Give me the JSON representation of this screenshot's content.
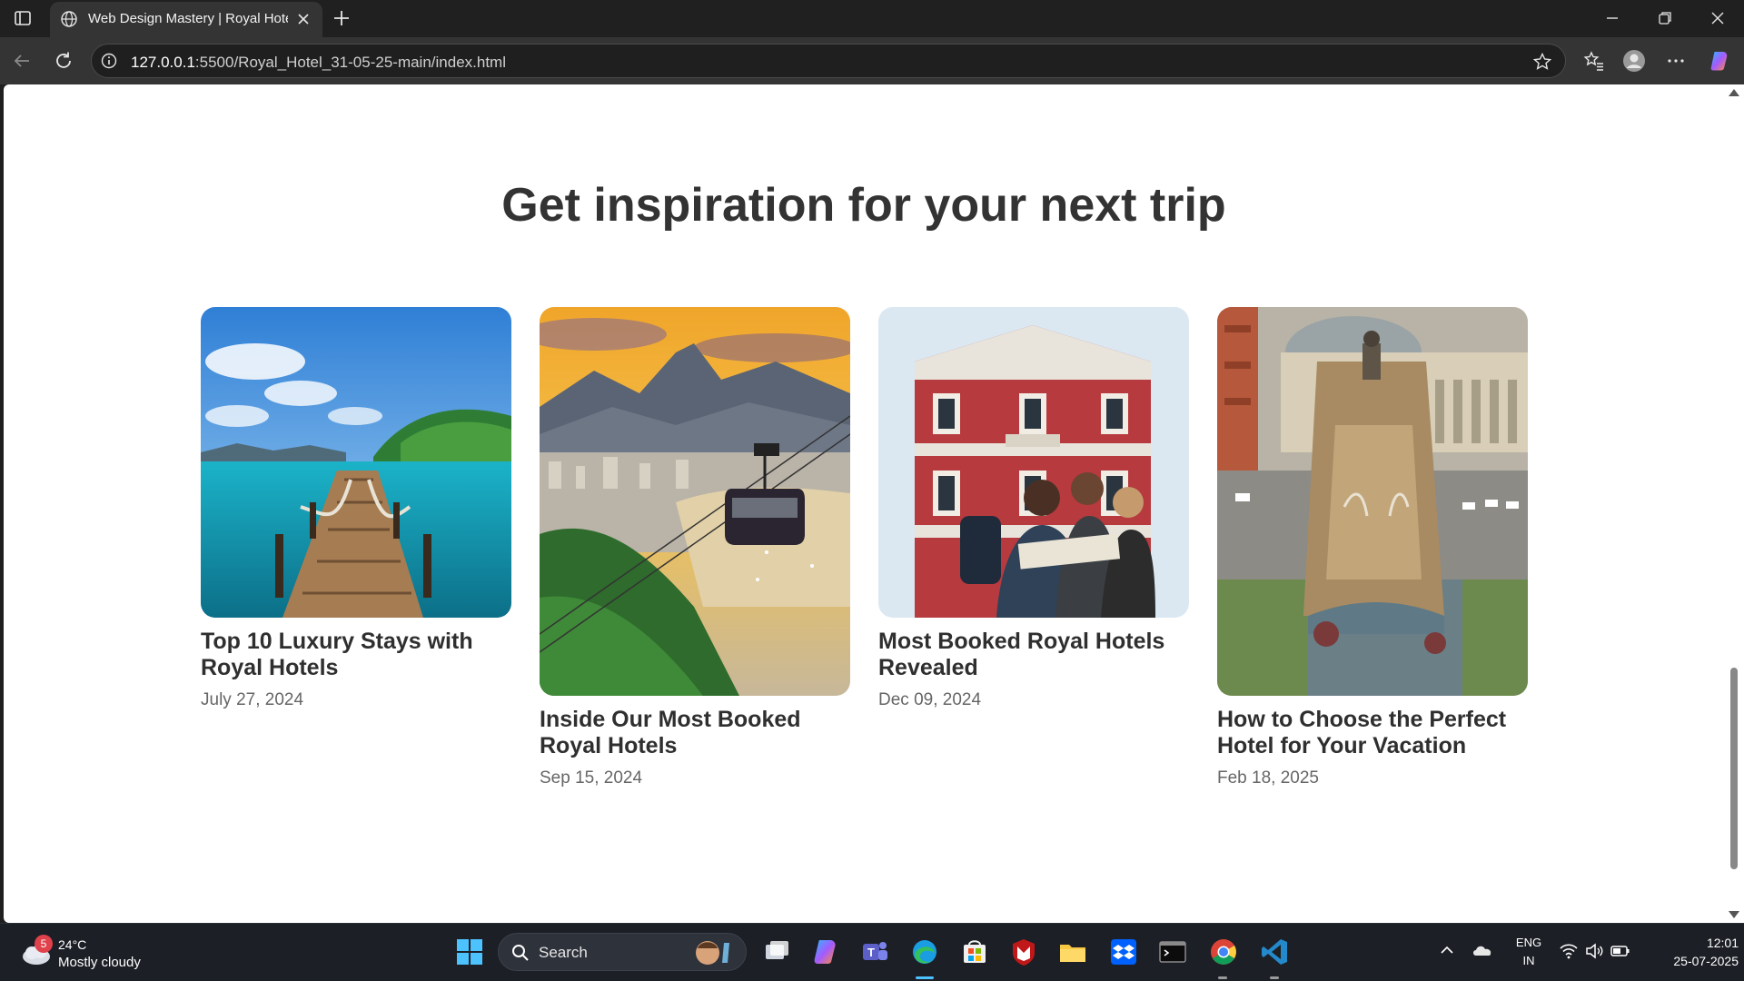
{
  "browser": {
    "tab_title": "Web Design Mastery | Royal Hotel",
    "url_host": "127.0.0.1",
    "url_rest": ":5500/Royal_Hotel_31-05-25-main/index.html"
  },
  "page": {
    "section_title": "Get inspiration for your next trip",
    "cards": [
      {
        "title": "Top 10 Luxury Stays with Royal Hotels",
        "date": "July 27, 2024",
        "image": "tropical-pier"
      },
      {
        "title": "Inside Our Most Booked Royal Hotels",
        "date": "Sep 15, 2024",
        "image": "cable-car-city"
      },
      {
        "title": "Most Booked Royal Hotels Revealed",
        "date": "Dec 09, 2024",
        "image": "travelers-red-building"
      },
      {
        "title": "How to Choose the Perfect Hotel for Your Vacation",
        "date": "Feb 18, 2025",
        "image": "fountain-plaza"
      }
    ]
  },
  "taskbar": {
    "weather_badge": "5",
    "temperature": "24°C",
    "condition": "Mostly cloudy",
    "search_label": "Search",
    "language_line1": "ENG",
    "language_line2": "IN",
    "time": "12:01",
    "date": "25-07-2025",
    "apps": [
      "file-explorer-view-icon",
      "copilot-icon",
      "teams-icon",
      "edge-icon",
      "store-icon",
      "mcafee-icon",
      "folder-icon",
      "dropbox-icon",
      "terminal-icon",
      "chrome-icon",
      "vscode-icon"
    ]
  }
}
